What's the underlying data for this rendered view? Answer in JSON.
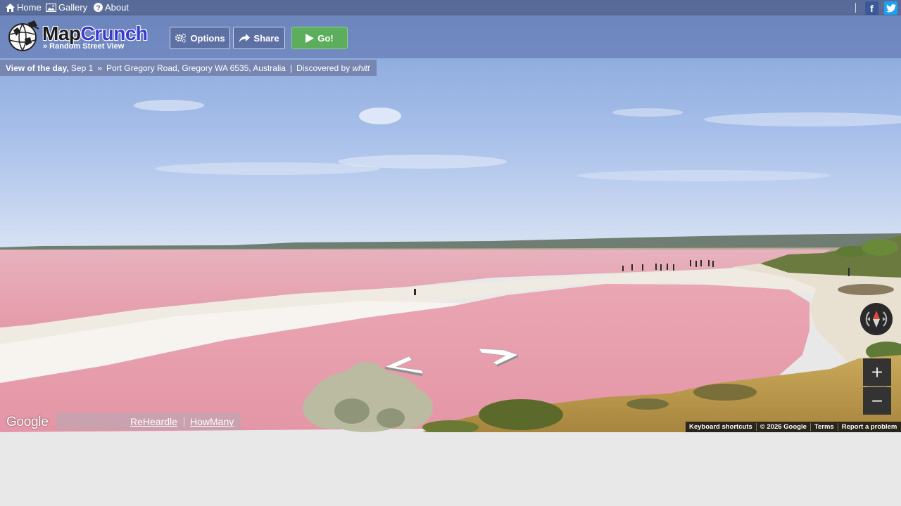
{
  "topnav": {
    "home": "Home",
    "gallery": "Gallery",
    "about": "About",
    "facebook_icon": "f"
  },
  "header": {
    "logo_map": "Map",
    "logo_crunch": "Crunch",
    "logo_sub": "» Random Street View",
    "options_label": "Options",
    "share_label": "Share",
    "go_label": "Go!",
    "go_color": "#5cad5c"
  },
  "votd": {
    "prefix": "View of the day,",
    "date": "Sep 1",
    "sep1": "»",
    "location": "Port Gregory Road, Gregory WA 6535, Australia",
    "sep2": "|",
    "discovered": "Discovered by",
    "user": "whitt"
  },
  "map": {
    "google": "Google",
    "zoom_in": "+",
    "zoom_out": "−",
    "links": {
      "reheardle": "ReHeardle",
      "howmany": "HowMany"
    },
    "attribution": {
      "shortcuts": "Keyboard shortcuts",
      "copyright": "© 2026 Google",
      "terms": "Terms",
      "report": "Report a problem"
    }
  },
  "colors": {
    "lake": "#e6a4b0",
    "sky": "#a9c2ea"
  }
}
